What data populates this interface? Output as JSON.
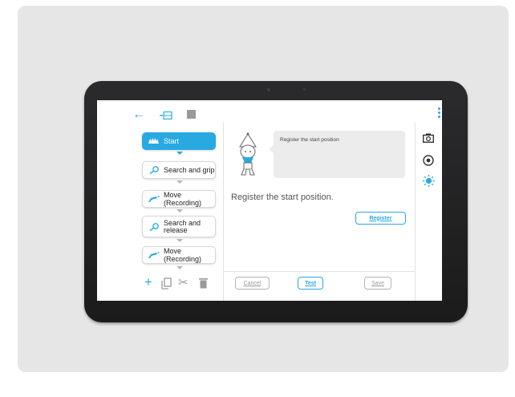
{
  "steps": [
    {
      "label": "Start",
      "icon": "hand-icon",
      "active": true
    },
    {
      "label": "Search and grip",
      "icon": "magnifier-icon"
    },
    {
      "label": "Move (Recording)",
      "icon": "robot-arm-icon"
    },
    {
      "label": "Search and release",
      "icon": "magnifier-icon"
    },
    {
      "label": "Move (Recording)",
      "icon": "robot-arm-icon"
    }
  ],
  "bubble_text": "Register the start position",
  "instruction": "Register the start position.",
  "buttons": {
    "register": "Register",
    "cancel": "Cancel",
    "test": "Test",
    "save": "Save"
  },
  "colors": {
    "accent": "#29a9e1",
    "muted": "#9a9a9a"
  }
}
